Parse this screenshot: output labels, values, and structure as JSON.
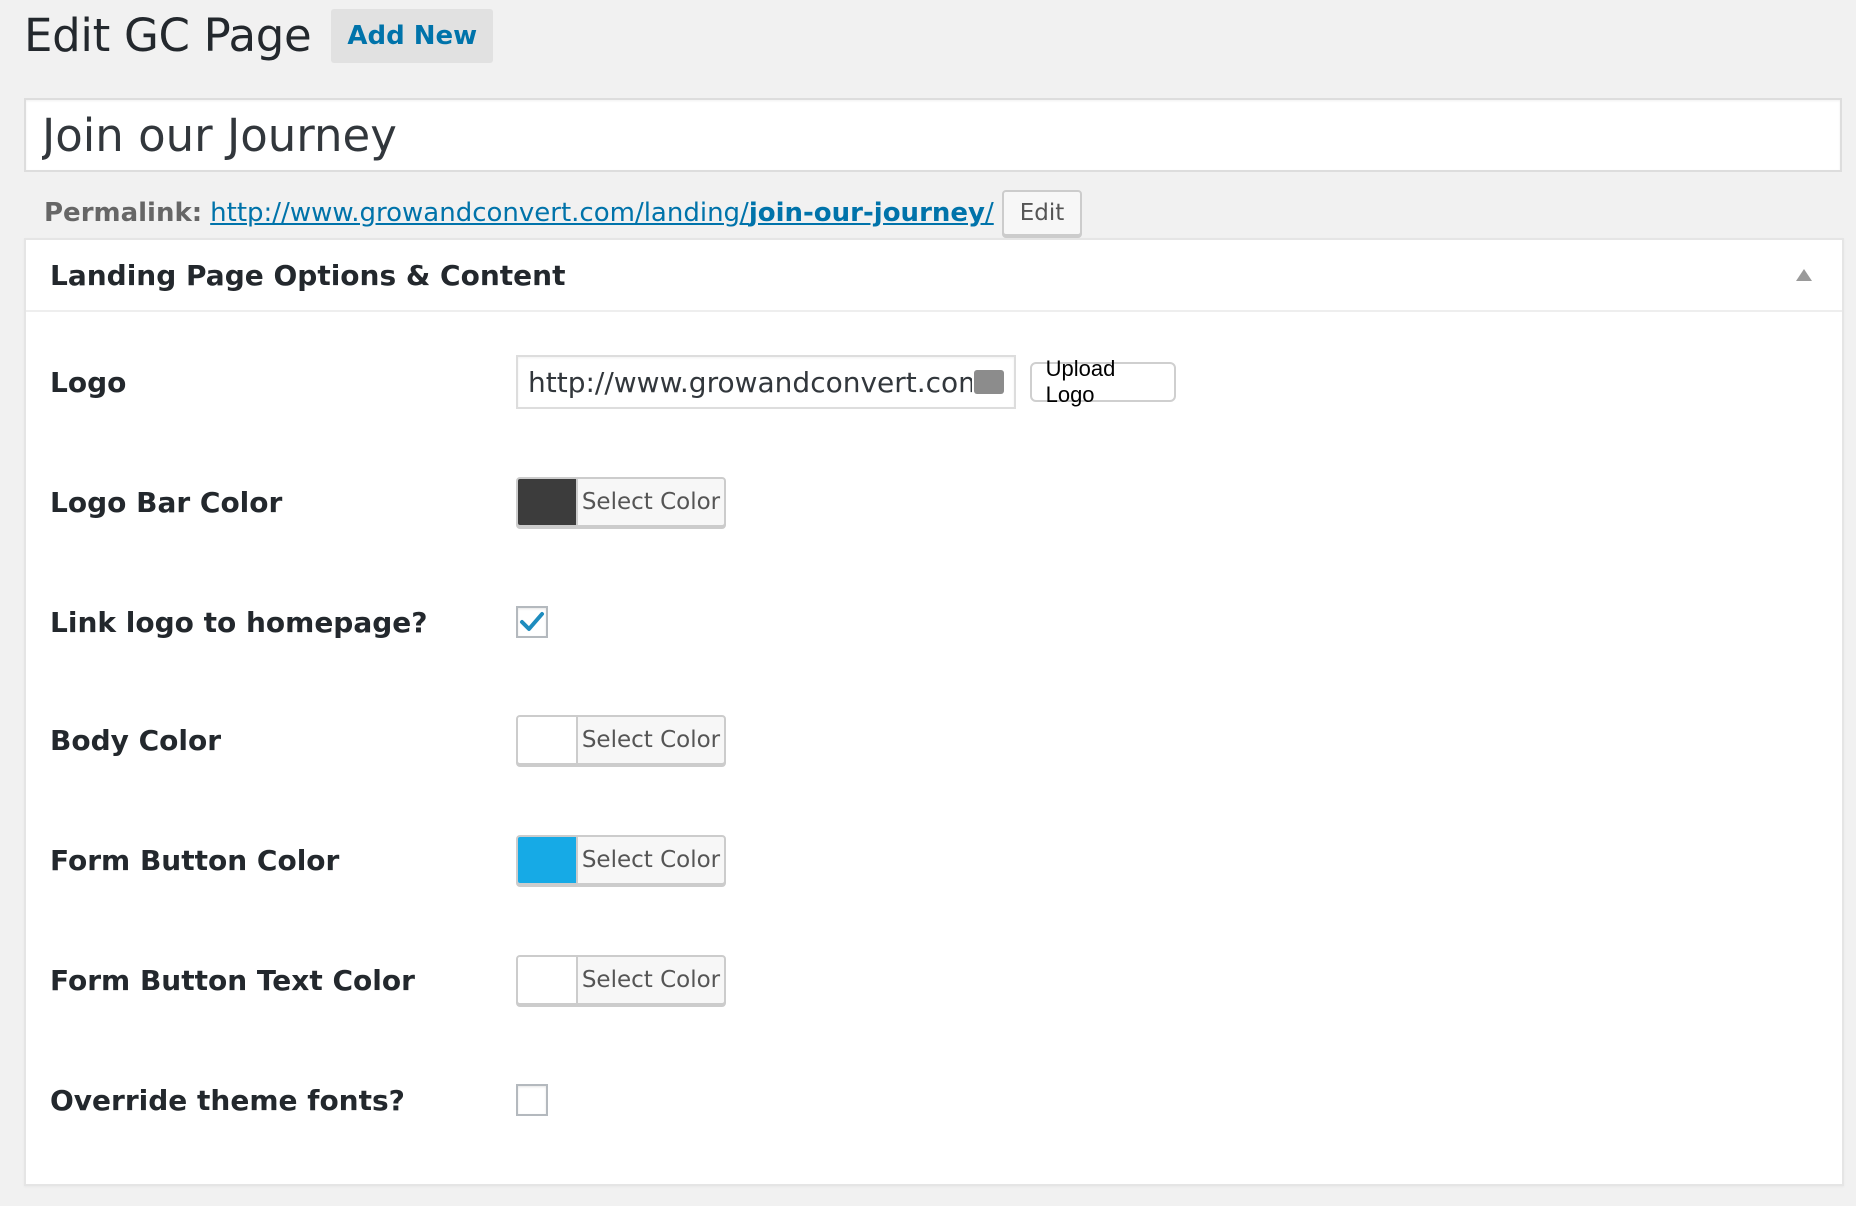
{
  "header": {
    "title": "Edit GC Page",
    "add_new_label": "Add New"
  },
  "post": {
    "title": "Join our Journey"
  },
  "permalink": {
    "label": "Permalink:",
    "base_url": "http://www.growandconvert.com/landing/",
    "slug": "join-our-journey",
    "trailing": "/",
    "edit_label": "Edit"
  },
  "meta_box": {
    "title": "Landing Page Options & Content",
    "toggle_icon": "triangle-up-icon"
  },
  "fields": {
    "logo": {
      "label": "Logo",
      "value": "http://www.growandconvert.com/wp-co",
      "upload_label": "Upload Logo"
    },
    "logo_bar_color": {
      "label": "Logo Bar Color",
      "color": "#3c3c3c",
      "button_label": "Select Color"
    },
    "link_logo": {
      "label": "Link logo to homepage?",
      "checked": true
    },
    "body_color": {
      "label": "Body Color",
      "color": "#ffffff",
      "button_label": "Select Color"
    },
    "form_button_color": {
      "label": "Form Button Color",
      "color": "#16aae6",
      "button_label": "Select Color"
    },
    "form_button_text_color": {
      "label": "Form Button Text Color",
      "color": "#ffffff",
      "button_label": "Select Color"
    },
    "override_fonts": {
      "label": "Override theme fonts?",
      "checked": false
    }
  },
  "colors": {
    "link": "#0073aa",
    "checkmark": "#1e8cbe"
  }
}
